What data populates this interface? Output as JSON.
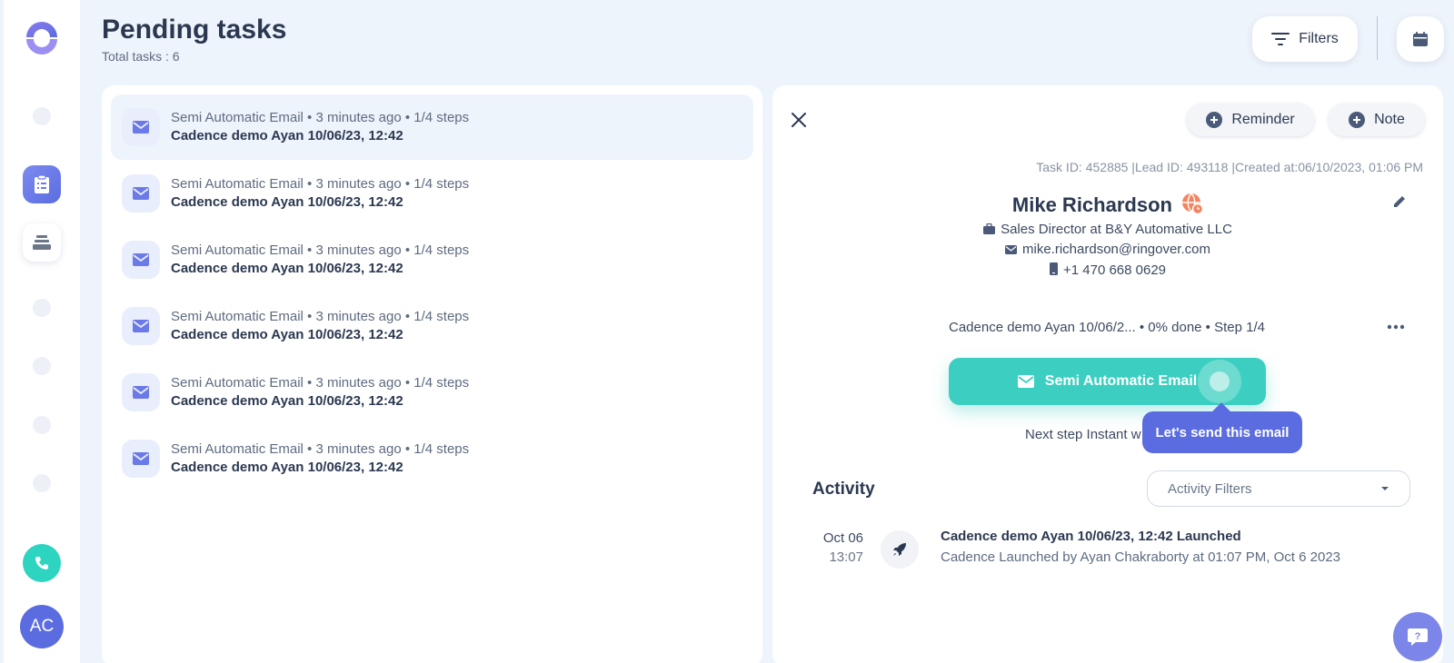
{
  "header": {
    "title": "Pending tasks",
    "total": "Total tasks : 6",
    "filters_label": "Filters"
  },
  "sidebar": {
    "avatar_initials": "AC"
  },
  "tasks": [
    {
      "meta": "Semi Automatic Email • 3 minutes ago • 1/4 steps",
      "name": "Cadence demo Ayan 10/06/23, 12:42"
    },
    {
      "meta": "Semi Automatic Email • 3 minutes ago • 1/4 steps",
      "name": "Cadence demo Ayan 10/06/23, 12:42"
    },
    {
      "meta": "Semi Automatic Email • 3 minutes ago • 1/4 steps",
      "name": "Cadence demo Ayan 10/06/23, 12:42"
    },
    {
      "meta": "Semi Automatic Email • 3 minutes ago • 1/4 steps",
      "name": "Cadence demo Ayan 10/06/23, 12:42"
    },
    {
      "meta": "Semi Automatic Email • 3 minutes ago • 1/4 steps",
      "name": "Cadence demo Ayan 10/06/23, 12:42"
    },
    {
      "meta": "Semi Automatic Email • 3 minutes ago • 1/4 steps",
      "name": "Cadence demo Ayan 10/06/23, 12:42"
    }
  ],
  "detail": {
    "reminder_label": "Reminder",
    "note_label": "Note",
    "ids_line": "Task ID: 452885 |Lead ID: 493118 |Created at:06/10/2023, 01:06 PM",
    "lead_name": "Mike Richardson",
    "job": "Sales Director  at  B&Y Automative LLC",
    "email": "mike.richardson@ringover.com",
    "phone": "+1 470 668 0629",
    "cadence_line": "Cadence demo Ayan 10/06/2... • 0% done • Step 1/4",
    "action_label": "Semi Automatic Email",
    "next_step": "Next step Instant w",
    "tooltip": "Let's send this email"
  },
  "activity": {
    "title": "Activity",
    "filter_placeholder": "Activity Filters",
    "items": [
      {
        "date": "Oct 06",
        "time": "13:07",
        "title": "Cadence demo Ayan 10/06/23, 12:42 Launched",
        "desc": "Cadence Launched by Ayan Chakraborty at 01:07 PM, Oct 6 2023"
      }
    ]
  },
  "colors": {
    "accent": "#5b6ce0",
    "teal": "#3ccfc1",
    "background": "#eef4fb"
  }
}
